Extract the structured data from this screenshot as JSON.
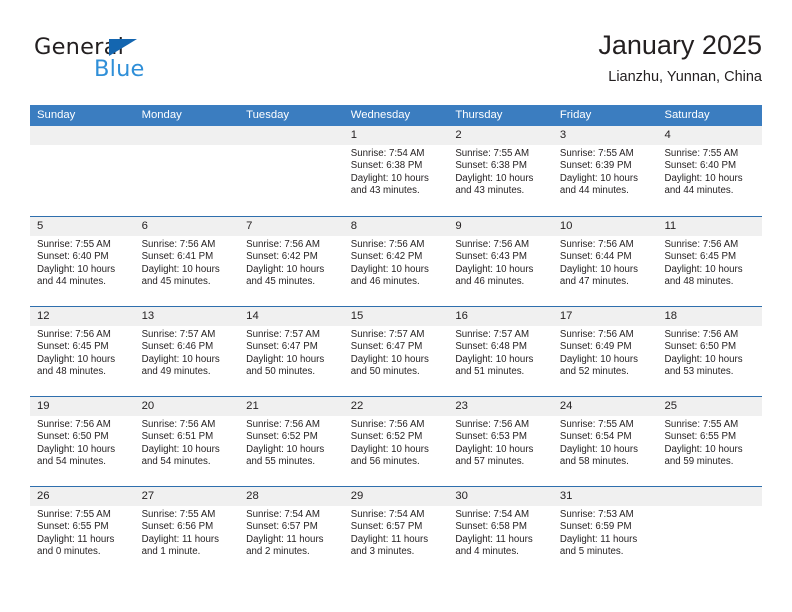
{
  "brand": {
    "word_one": "General",
    "word_two": "Blue",
    "triangle_icon": "triangle-logo-icon",
    "accent_dark": "#1466b0",
    "accent_light": "#2f8fd8"
  },
  "header": {
    "title": "January 2025",
    "subtitle": "Lianzhu, Yunnan, China"
  },
  "theme": {
    "header_blue": "#3b7dc0",
    "row_divider": "#2f6fad",
    "day_band": "#f0f0f0",
    "text": "#231f20"
  },
  "weekdays": [
    "Sunday",
    "Monday",
    "Tuesday",
    "Wednesday",
    "Thursday",
    "Friday",
    "Saturday"
  ],
  "weeks": [
    [
      {
        "day": "",
        "sunrise": "",
        "sunset": "",
        "daylight_line1": "",
        "daylight_line2": ""
      },
      {
        "day": "",
        "sunrise": "",
        "sunset": "",
        "daylight_line1": "",
        "daylight_line2": ""
      },
      {
        "day": "",
        "sunrise": "",
        "sunset": "",
        "daylight_line1": "",
        "daylight_line2": ""
      },
      {
        "day": "1",
        "sunrise": "Sunrise: 7:54 AM",
        "sunset": "Sunset: 6:38 PM",
        "daylight_line1": "Daylight: 10 hours",
        "daylight_line2": "and 43 minutes."
      },
      {
        "day": "2",
        "sunrise": "Sunrise: 7:55 AM",
        "sunset": "Sunset: 6:38 PM",
        "daylight_line1": "Daylight: 10 hours",
        "daylight_line2": "and 43 minutes."
      },
      {
        "day": "3",
        "sunrise": "Sunrise: 7:55 AM",
        "sunset": "Sunset: 6:39 PM",
        "daylight_line1": "Daylight: 10 hours",
        "daylight_line2": "and 44 minutes."
      },
      {
        "day": "4",
        "sunrise": "Sunrise: 7:55 AM",
        "sunset": "Sunset: 6:40 PM",
        "daylight_line1": "Daylight: 10 hours",
        "daylight_line2": "and 44 minutes."
      }
    ],
    [
      {
        "day": "5",
        "sunrise": "Sunrise: 7:55 AM",
        "sunset": "Sunset: 6:40 PM",
        "daylight_line1": "Daylight: 10 hours",
        "daylight_line2": "and 44 minutes."
      },
      {
        "day": "6",
        "sunrise": "Sunrise: 7:56 AM",
        "sunset": "Sunset: 6:41 PM",
        "daylight_line1": "Daylight: 10 hours",
        "daylight_line2": "and 45 minutes."
      },
      {
        "day": "7",
        "sunrise": "Sunrise: 7:56 AM",
        "sunset": "Sunset: 6:42 PM",
        "daylight_line1": "Daylight: 10 hours",
        "daylight_line2": "and 45 minutes."
      },
      {
        "day": "8",
        "sunrise": "Sunrise: 7:56 AM",
        "sunset": "Sunset: 6:42 PM",
        "daylight_line1": "Daylight: 10 hours",
        "daylight_line2": "and 46 minutes."
      },
      {
        "day": "9",
        "sunrise": "Sunrise: 7:56 AM",
        "sunset": "Sunset: 6:43 PM",
        "daylight_line1": "Daylight: 10 hours",
        "daylight_line2": "and 46 minutes."
      },
      {
        "day": "10",
        "sunrise": "Sunrise: 7:56 AM",
        "sunset": "Sunset: 6:44 PM",
        "daylight_line1": "Daylight: 10 hours",
        "daylight_line2": "and 47 minutes."
      },
      {
        "day": "11",
        "sunrise": "Sunrise: 7:56 AM",
        "sunset": "Sunset: 6:45 PM",
        "daylight_line1": "Daylight: 10 hours",
        "daylight_line2": "and 48 minutes."
      }
    ],
    [
      {
        "day": "12",
        "sunrise": "Sunrise: 7:56 AM",
        "sunset": "Sunset: 6:45 PM",
        "daylight_line1": "Daylight: 10 hours",
        "daylight_line2": "and 48 minutes."
      },
      {
        "day": "13",
        "sunrise": "Sunrise: 7:57 AM",
        "sunset": "Sunset: 6:46 PM",
        "daylight_line1": "Daylight: 10 hours",
        "daylight_line2": "and 49 minutes."
      },
      {
        "day": "14",
        "sunrise": "Sunrise: 7:57 AM",
        "sunset": "Sunset: 6:47 PM",
        "daylight_line1": "Daylight: 10 hours",
        "daylight_line2": "and 50 minutes."
      },
      {
        "day": "15",
        "sunrise": "Sunrise: 7:57 AM",
        "sunset": "Sunset: 6:47 PM",
        "daylight_line1": "Daylight: 10 hours",
        "daylight_line2": "and 50 minutes."
      },
      {
        "day": "16",
        "sunrise": "Sunrise: 7:57 AM",
        "sunset": "Sunset: 6:48 PM",
        "daylight_line1": "Daylight: 10 hours",
        "daylight_line2": "and 51 minutes."
      },
      {
        "day": "17",
        "sunrise": "Sunrise: 7:56 AM",
        "sunset": "Sunset: 6:49 PM",
        "daylight_line1": "Daylight: 10 hours",
        "daylight_line2": "and 52 minutes."
      },
      {
        "day": "18",
        "sunrise": "Sunrise: 7:56 AM",
        "sunset": "Sunset: 6:50 PM",
        "daylight_line1": "Daylight: 10 hours",
        "daylight_line2": "and 53 minutes."
      }
    ],
    [
      {
        "day": "19",
        "sunrise": "Sunrise: 7:56 AM",
        "sunset": "Sunset: 6:50 PM",
        "daylight_line1": "Daylight: 10 hours",
        "daylight_line2": "and 54 minutes."
      },
      {
        "day": "20",
        "sunrise": "Sunrise: 7:56 AM",
        "sunset": "Sunset: 6:51 PM",
        "daylight_line1": "Daylight: 10 hours",
        "daylight_line2": "and 54 minutes."
      },
      {
        "day": "21",
        "sunrise": "Sunrise: 7:56 AM",
        "sunset": "Sunset: 6:52 PM",
        "daylight_line1": "Daylight: 10 hours",
        "daylight_line2": "and 55 minutes."
      },
      {
        "day": "22",
        "sunrise": "Sunrise: 7:56 AM",
        "sunset": "Sunset: 6:52 PM",
        "daylight_line1": "Daylight: 10 hours",
        "daylight_line2": "and 56 minutes."
      },
      {
        "day": "23",
        "sunrise": "Sunrise: 7:56 AM",
        "sunset": "Sunset: 6:53 PM",
        "daylight_line1": "Daylight: 10 hours",
        "daylight_line2": "and 57 minutes."
      },
      {
        "day": "24",
        "sunrise": "Sunrise: 7:55 AM",
        "sunset": "Sunset: 6:54 PM",
        "daylight_line1": "Daylight: 10 hours",
        "daylight_line2": "and 58 minutes."
      },
      {
        "day": "25",
        "sunrise": "Sunrise: 7:55 AM",
        "sunset": "Sunset: 6:55 PM",
        "daylight_line1": "Daylight: 10 hours",
        "daylight_line2": "and 59 minutes."
      }
    ],
    [
      {
        "day": "26",
        "sunrise": "Sunrise: 7:55 AM",
        "sunset": "Sunset: 6:55 PM",
        "daylight_line1": "Daylight: 11 hours",
        "daylight_line2": "and 0 minutes."
      },
      {
        "day": "27",
        "sunrise": "Sunrise: 7:55 AM",
        "sunset": "Sunset: 6:56 PM",
        "daylight_line1": "Daylight: 11 hours",
        "daylight_line2": "and 1 minute."
      },
      {
        "day": "28",
        "sunrise": "Sunrise: 7:54 AM",
        "sunset": "Sunset: 6:57 PM",
        "daylight_line1": "Daylight: 11 hours",
        "daylight_line2": "and 2 minutes."
      },
      {
        "day": "29",
        "sunrise": "Sunrise: 7:54 AM",
        "sunset": "Sunset: 6:57 PM",
        "daylight_line1": "Daylight: 11 hours",
        "daylight_line2": "and 3 minutes."
      },
      {
        "day": "30",
        "sunrise": "Sunrise: 7:54 AM",
        "sunset": "Sunset: 6:58 PM",
        "daylight_line1": "Daylight: 11 hours",
        "daylight_line2": "and 4 minutes."
      },
      {
        "day": "31",
        "sunrise": "Sunrise: 7:53 AM",
        "sunset": "Sunset: 6:59 PM",
        "daylight_line1": "Daylight: 11 hours",
        "daylight_line2": "and 5 minutes."
      },
      {
        "day": "",
        "sunrise": "",
        "sunset": "",
        "daylight_line1": "",
        "daylight_line2": ""
      }
    ]
  ]
}
